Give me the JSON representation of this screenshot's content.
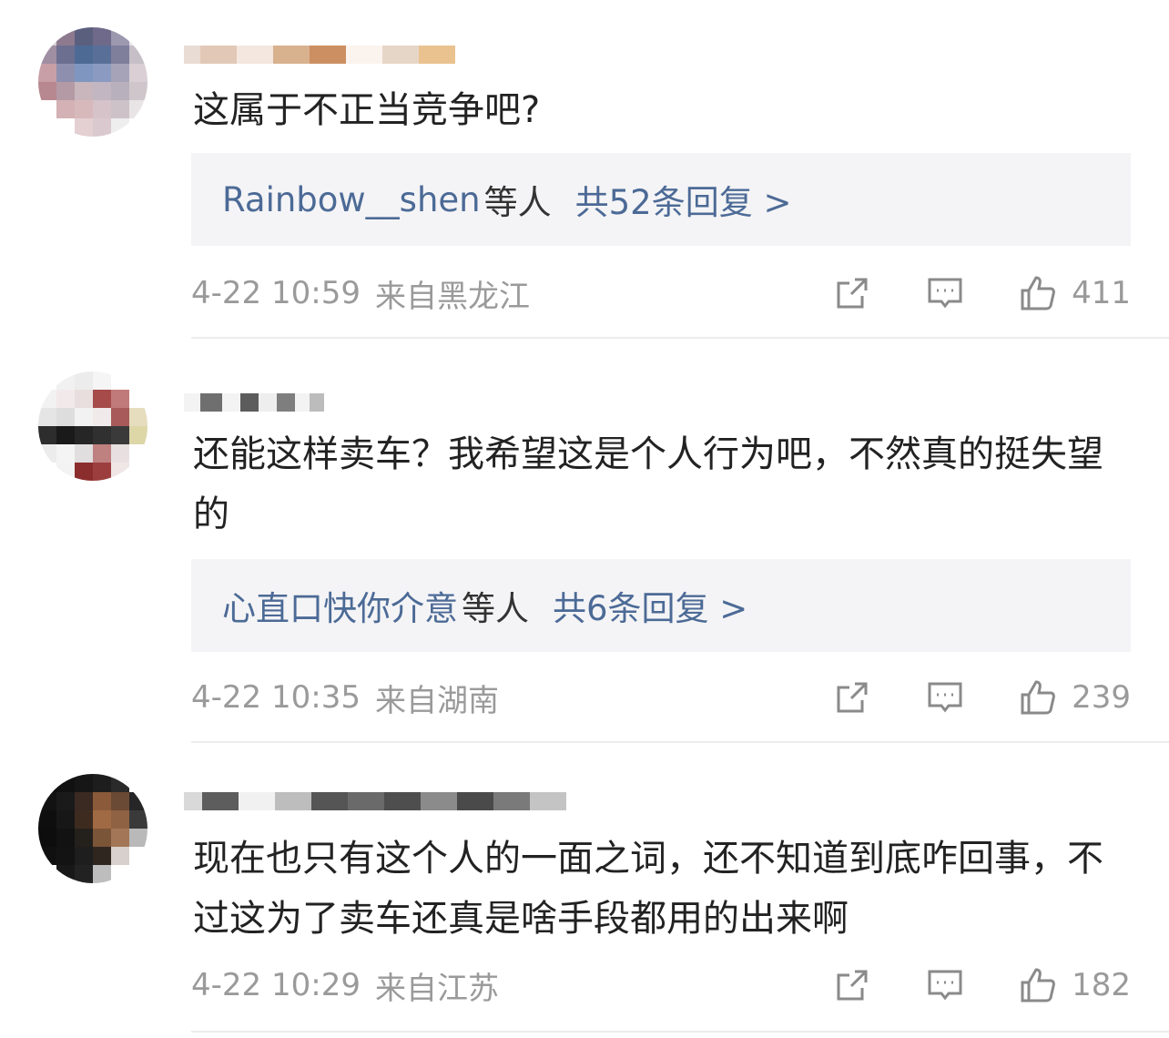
{
  "comments": [
    {
      "text": "这属于不正当竞争吧?",
      "reply_user": "Rainbow__shen",
      "reply_suffix": "等人",
      "reply_total": "共52条回复 >",
      "time": "4-22 10:59",
      "location": "来自黑龙江",
      "likes": "411"
    },
    {
      "text": "还能这样卖车？我希望这是个人行为吧，不然真的挺失望的",
      "reply_user": "心直口快你介意",
      "reply_suffix": "等人",
      "reply_total": "共6条回复 >",
      "time": "4-22 10:35",
      "location": "来自湖南",
      "likes": "239"
    },
    {
      "text": "现在也只有这个人的一面之词，还不知道到底咋回事，不过这为了卖车还真是啥手段都用的出来啊",
      "time": "4-22 10:29",
      "location": "来自江苏",
      "likes": "182"
    }
  ],
  "icons": [
    "share-icon",
    "comment-icon",
    "like-icon"
  ],
  "colors": {
    "link": "#4c6a96",
    "meta": "#9a9a9a",
    "reply_bg": "#f4f4f6"
  }
}
